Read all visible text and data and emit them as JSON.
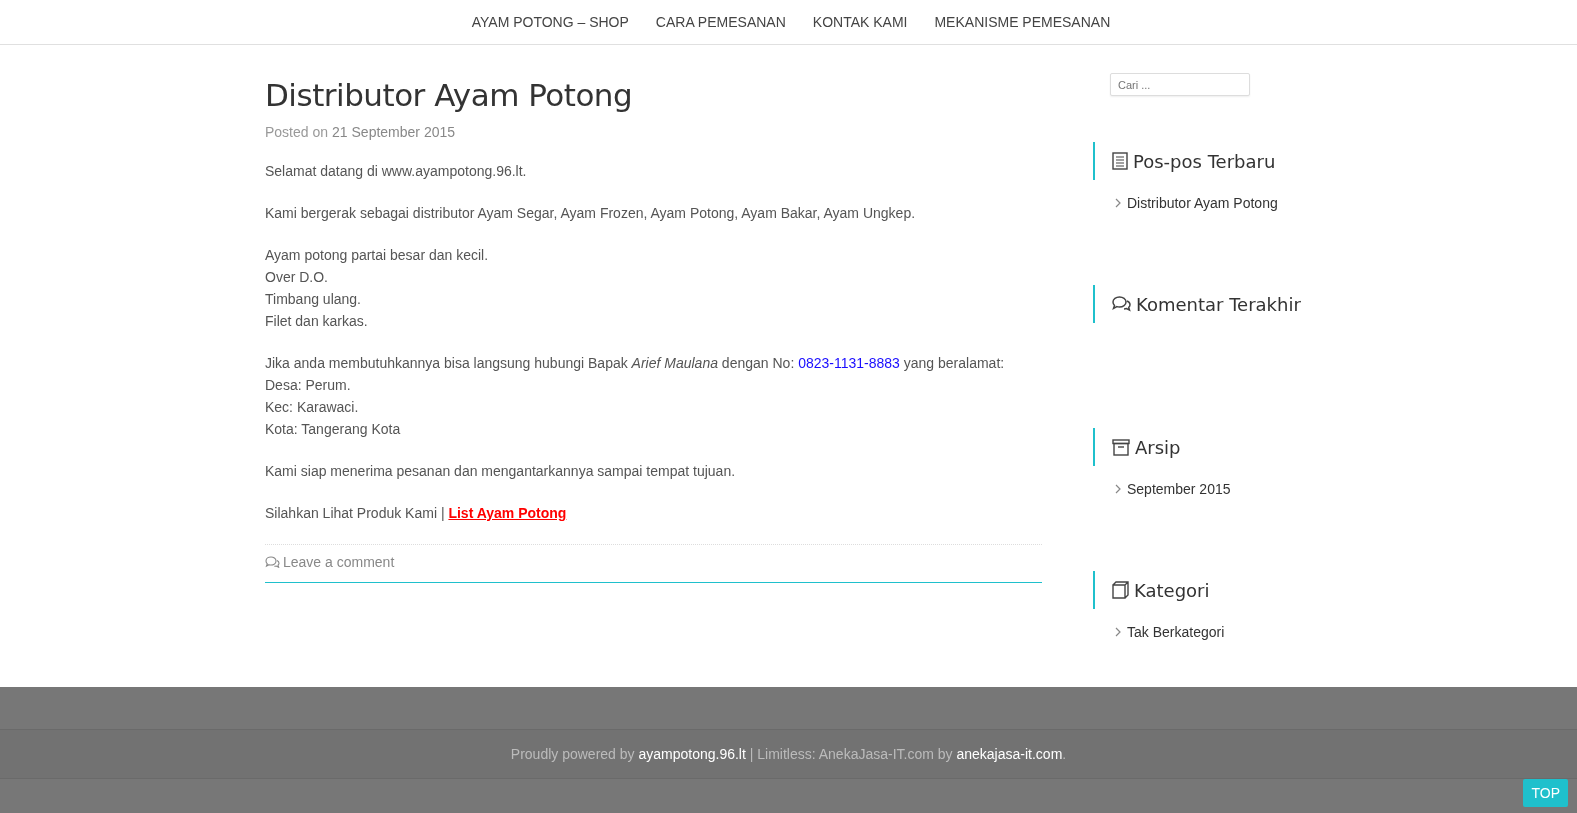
{
  "nav": [
    "AYAM POTONG – SHOP",
    "CARA PEMESANAN",
    "KONTAK KAMI",
    "MEKANISME PEMESANAN"
  ],
  "post": {
    "title": "Distributor Ayam Potong",
    "posted_label": "Posted on",
    "date": "21 September 2015",
    "paragraphs": [
      {
        "kind": "text",
        "lines": [
          "Selamat datang di www.ayampotong.96.lt."
        ]
      },
      {
        "kind": "text",
        "lines": [
          "Kami bergerak sebagai distributor Ayam Segar, Ayam Frozen, Ayam Potong, Ayam Bakar, Ayam Ungkep."
        ]
      },
      {
        "kind": "text",
        "lines": [
          "Ayam potong partai besar dan kecil.",
          "Over D.O.",
          "Timbang ulang.",
          "Filet dan karkas."
        ]
      },
      {
        "kind": "contact",
        "before": "Jika anda membutuhkannya bisa langsung hubungi Bapak *Arief Maulana* dengan No: ",
        "phone": "0823-1131-8883",
        "after": " yang beralamat:",
        "lines": [
          "Desa: Perum.",
          "Kec: Karawaci.",
          "Kota: Tangerang Kota"
        ]
      },
      {
        "kind": "text",
        "lines": [
          "Kami siap menerima pesanan dan mengantarkannya sampai tempat tujuan."
        ]
      },
      {
        "kind": "link",
        "before": "Silahkan Lihat Produk Kami | ",
        "link": "List Ayam Potong"
      }
    ],
    "comment_link": "Leave a comment"
  },
  "search": {
    "placeholder": "Cari ..."
  },
  "widgets": [
    {
      "kind": "recent-posts",
      "title": "Pos-pos Terbaru",
      "items": [
        "Distributor Ayam Potong"
      ]
    },
    {
      "kind": "recent-comments",
      "title": "Komentar Terakhir"
    },
    {
      "kind": "archives",
      "title": "Arsip",
      "items": [
        "September 2015"
      ]
    },
    {
      "kind": "categories",
      "title": "Kategori",
      "items": [
        "Tak Berkategori"
      ]
    }
  ],
  "footer": {
    "prefix": "Proudly powered by",
    "site_link": "ayampotong.96.lt",
    "middle": "| Limitless: AnekaJasa-IT.com by",
    "theme_link": "anekajasa-it.com",
    "suffix": "."
  },
  "top_button": "TOP"
}
